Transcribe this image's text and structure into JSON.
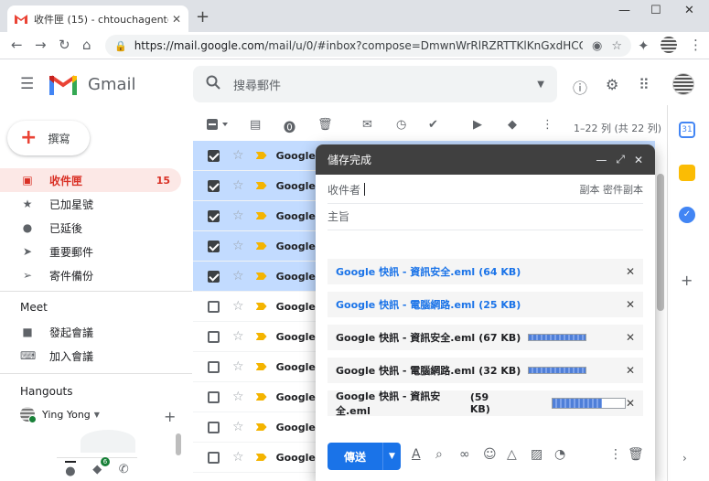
{
  "browser": {
    "tab_title": "收件匣 (15) - chtouchagent@g",
    "url_host": "https://mail.google.com",
    "url_path": "/mail/u/0/#inbox?compose=DmwnWrRlRZRTTKlKnGxdHCCfN..."
  },
  "header": {
    "brand": "Gmail",
    "search_placeholder": "搜尋郵件"
  },
  "sidebar": {
    "compose_label": "撰寫",
    "items": [
      {
        "label": "收件匣",
        "count": "15",
        "icon": "inbox-icon"
      },
      {
        "label": "已加星號",
        "count": "",
        "icon": "star-icon"
      },
      {
        "label": "已延後",
        "count": "",
        "icon": "clock-icon"
      },
      {
        "label": "重要郵件",
        "count": "",
        "icon": "important-icon"
      },
      {
        "label": "寄件備份",
        "count": "",
        "icon": "send-icon"
      }
    ],
    "meet_title": "Meet",
    "meet_items": [
      {
        "label": "發起會議",
        "icon": "video-icon"
      },
      {
        "label": "加入會議",
        "icon": "keyboard-icon"
      }
    ],
    "hangouts_title": "Hangouts",
    "hangouts_user": "Ying Yong",
    "hangouts_badge": "6"
  },
  "toolbar": {
    "pager": "1–22 列 (共 22 列)"
  },
  "mail_rows": [
    {
      "sender": "Google A",
      "selected": true
    },
    {
      "sender": "Google A",
      "selected": true
    },
    {
      "sender": "Google A",
      "selected": true
    },
    {
      "sender": "Google A",
      "selected": true
    },
    {
      "sender": "Google A",
      "selected": true
    },
    {
      "sender": "Google A",
      "selected": false
    },
    {
      "sender": "Google A",
      "selected": false
    },
    {
      "sender": "Google A",
      "selected": false
    },
    {
      "sender": "Google A",
      "selected": false
    },
    {
      "sender": "Google A",
      "selected": false
    },
    {
      "sender": "Google A",
      "selected": false
    }
  ],
  "compose": {
    "title": "儲存完成",
    "to_label": "收件者",
    "cc_bcc": "副本 密件副本",
    "subject_label": "主旨",
    "send_label": "傳送",
    "attachments": [
      {
        "name": "Google 快訊 - 資訊安全.eml",
        "size": "(64 KB)",
        "done": true,
        "progress": 1
      },
      {
        "name": "Google 快訊 - 電腦網路.eml",
        "size": "(25 KB)",
        "done": true,
        "progress": 1
      },
      {
        "name": "Google 快訊 - 資訊安全.eml",
        "size": "(67 KB)",
        "done": false,
        "progress": 1
      },
      {
        "name": "Google 快訊 - 電腦網路.eml",
        "size": "(32 KB)",
        "done": false,
        "progress": 1
      },
      {
        "name": "Google 快訊 - 資訊安全.eml",
        "size": "(59 KB)",
        "done": false,
        "progress": 0.68
      }
    ]
  },
  "colors": {
    "accent": "#1a73e8",
    "inbox_active": "#d93025",
    "selected_row": "#c2dbff",
    "compose_header": "#404040"
  }
}
